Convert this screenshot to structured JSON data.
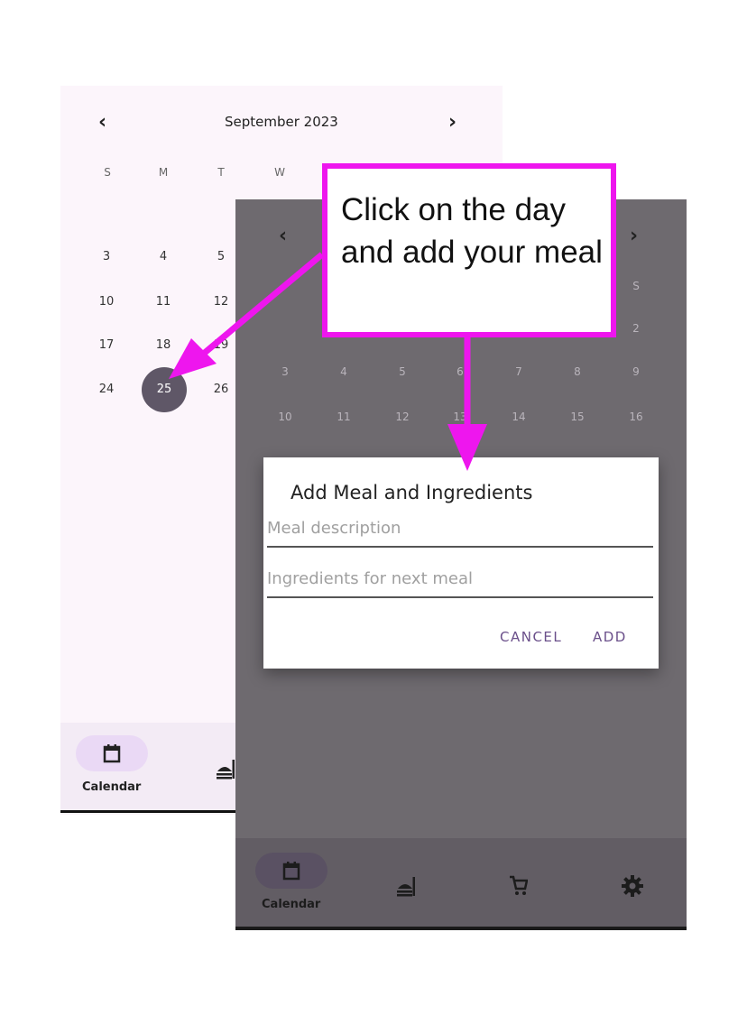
{
  "back_screen": {
    "month_title": "September 2023",
    "prev_glyph": "‹",
    "next_glyph": "›",
    "weekdays": [
      "S",
      "M",
      "T",
      "W"
    ],
    "days": [
      "3",
      "4",
      "5",
      "10",
      "11",
      "12",
      "17",
      "18",
      "19",
      "24",
      "25",
      "26"
    ],
    "selected_day": "25",
    "nav": {
      "calendar_label": "Calendar"
    },
    "icons": [
      "calendar-icon",
      "meal-icon"
    ]
  },
  "front_screen": {
    "prev_glyph": "‹",
    "next_glyph": "›",
    "partial_weekday_s": "S",
    "day_row_partial": [
      "2"
    ],
    "day_row_3_9": [
      "3",
      "4",
      "5",
      "6",
      "7",
      "8",
      "9"
    ],
    "day_row_10_16": [
      "10",
      "11",
      "12",
      "13",
      "14",
      "15",
      "16"
    ],
    "nav": {
      "calendar_label": "Calendar"
    },
    "icons": [
      "calendar-icon",
      "meal-icon",
      "cart-icon",
      "settings-icon"
    ]
  },
  "dialog": {
    "title": "Add Meal and Ingredients",
    "meal_placeholder": "Meal description",
    "ingredients_placeholder": "Ingredients for next meal",
    "cancel_label": "CANCEL",
    "add_label": "ADD"
  },
  "annotation": {
    "text": "Click on the day and add your meal",
    "color": "#ee16ee"
  },
  "colors": {
    "selected_day": "#5f5767",
    "accent_text": "#6a4f8a",
    "annotation": "#ee16ee"
  }
}
